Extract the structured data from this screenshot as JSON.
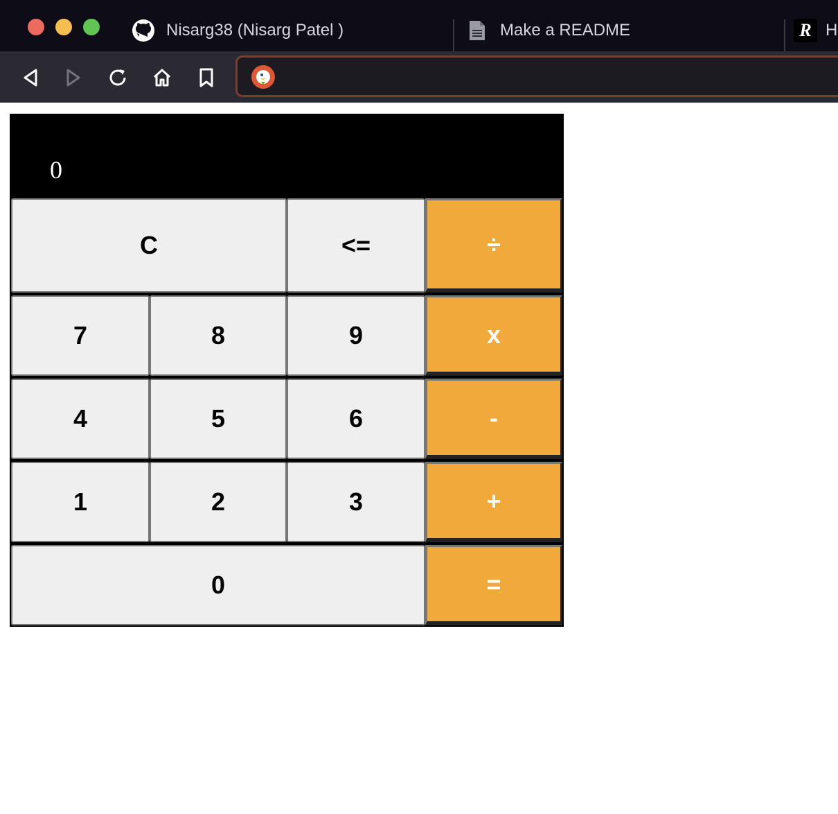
{
  "browser": {
    "tabs": [
      {
        "label": "Nisarg38 (Nisarg Patel )",
        "icon": "github-icon"
      },
      {
        "label": "Make a README",
        "icon": "document-icon"
      },
      {
        "label": "H",
        "icon": "r-logo-icon"
      }
    ],
    "nav": {
      "back_icon": "back-icon",
      "forward_icon": "forward-icon",
      "reload_icon": "reload-icon",
      "home_icon": "home-icon",
      "bookmark_icon": "bookmark-icon"
    },
    "url_value": "",
    "search_engine_icon": "duckduckgo-icon"
  },
  "calculator": {
    "display": "0",
    "keys": {
      "clear": "C",
      "backspace": "<=",
      "divide": "÷",
      "seven": "7",
      "eight": "8",
      "nine": "9",
      "multiply": "x",
      "four": "4",
      "five": "5",
      "six": "6",
      "subtract": "-",
      "one": "1",
      "two": "2",
      "three": "3",
      "add": "+",
      "zero": "0",
      "equals": "="
    },
    "colors": {
      "operator": "#f2a93b",
      "number_key": "#efefef",
      "display_bg": "#000000",
      "display_text": "#ffffff"
    }
  }
}
